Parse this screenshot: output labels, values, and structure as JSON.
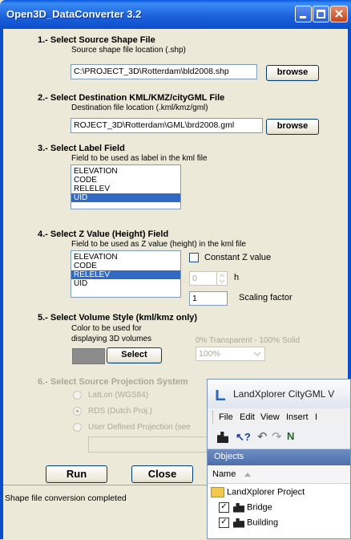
{
  "window": {
    "title": "Open3D_DataConverter 3.2"
  },
  "section1": {
    "title": "1.- Select Source Shape File",
    "subtitle": "Source shape file location (.shp)",
    "path": "C:\\PROJECT_3D\\Rotterdam\\bld2008.shp",
    "browse": "browse"
  },
  "section2": {
    "title": "2.- Select Destination KML/KMZ/cityGML File",
    "subtitle": "Destination file location (.kml/kmz/gml)",
    "path": "ROJECT_3D\\Rotterdam\\GML\\brd2008.gml",
    "browse": "browse"
  },
  "section3": {
    "title": "3.- Select Label Field",
    "subtitle": "Field to be used as label in the kml file",
    "fields": [
      "ELEVATION",
      "CODE",
      "RELELEV",
      "UID"
    ],
    "selected": "UID"
  },
  "section4": {
    "title": "4.- Select Z Value (Height) Field",
    "subtitle": "Field to be used as Z value (height) in the kml file",
    "fields": [
      "ELEVATION",
      "CODE",
      "RELELEV",
      "UID"
    ],
    "selected": "RELELEV",
    "constant_label": "Constant Z value",
    "constant_value": "0",
    "h_label": "h",
    "scaling_value": "1",
    "scaling_label": "Scaling factor"
  },
  "section5": {
    "title": "5.- Select Volume Style (kml/kmz only)",
    "color_line1": "Color to be used for",
    "color_line2": "displaying 3D volumes",
    "select": "Select",
    "transparency_label": "0% Transparent - 100% Solid",
    "transparency_value": "100%",
    "swatch_color": "#8c8c8c"
  },
  "section6": {
    "title": "6.- Select Source Projection System",
    "options": [
      "LatLon (WGS84)",
      "RDS (Dutch Proj.)",
      "User Defined Projection (see"
    ],
    "selected": "RDS (Dutch Proj.)"
  },
  "actions": {
    "run": "Run",
    "close": "Close"
  },
  "status": "Shape file conversion completed",
  "landxplorer": {
    "title": "LandXplorer CityGML V",
    "menu": [
      "File",
      "Edit",
      "View",
      "Insert",
      "I"
    ],
    "objects_label": "Objects",
    "name_header": "Name",
    "tree": [
      {
        "label": "LandXplorer Project",
        "icon": "folder-icon"
      },
      {
        "label": "Bridge",
        "icon": "building-icon",
        "checked": true
      },
      {
        "label": "Building",
        "icon": "building-icon",
        "checked": true
      }
    ]
  }
}
